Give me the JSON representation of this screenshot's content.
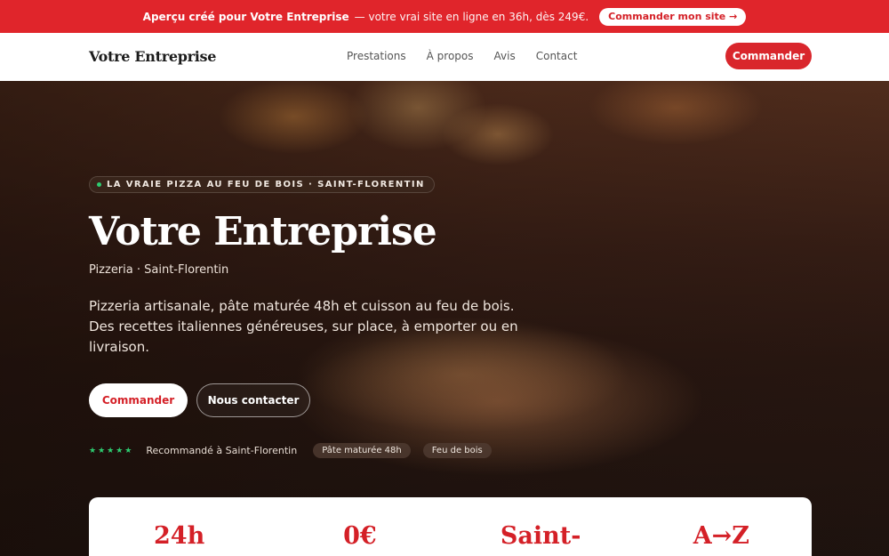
{
  "promo": {
    "text_bold": "Aperçu créé pour Votre Entreprise",
    "text_rest": "— votre vrai site en ligne en 36h, dès 249€.",
    "button_label": "Commander mon site →"
  },
  "header": {
    "brand": "Votre Entreprise",
    "nav": [
      "Prestations",
      "À propos",
      "Avis",
      "Contact"
    ],
    "cta_label": "Commander"
  },
  "hero": {
    "kicker": "LA VRAIE PIZZA AU FEU DE BOIS · SAINT-FLORENTIN",
    "title": "Votre Entreprise",
    "subtitle": "Pizzeria · Saint-Florentin",
    "description": "Pizzeria artisanale, pâte maturée 48h et cuisson au feu de bois. Des recettes italiennes généreuses, sur place, à emporter ou en livraison.",
    "primary_button": "Commander",
    "secondary_button": "Nous contacter",
    "rating_stars": "★★★★★",
    "rating_label": "Recommandé à Saint-Florentin",
    "chips": [
      "Pâte maturée 48h",
      "Feu de bois"
    ]
  },
  "stats": [
    "24h",
    "0€",
    "Saint-",
    "A→Z"
  ],
  "colors": {
    "accent_red": "#d9262c",
    "promo_red": "#e0252b",
    "star_green": "#2ecc71"
  }
}
